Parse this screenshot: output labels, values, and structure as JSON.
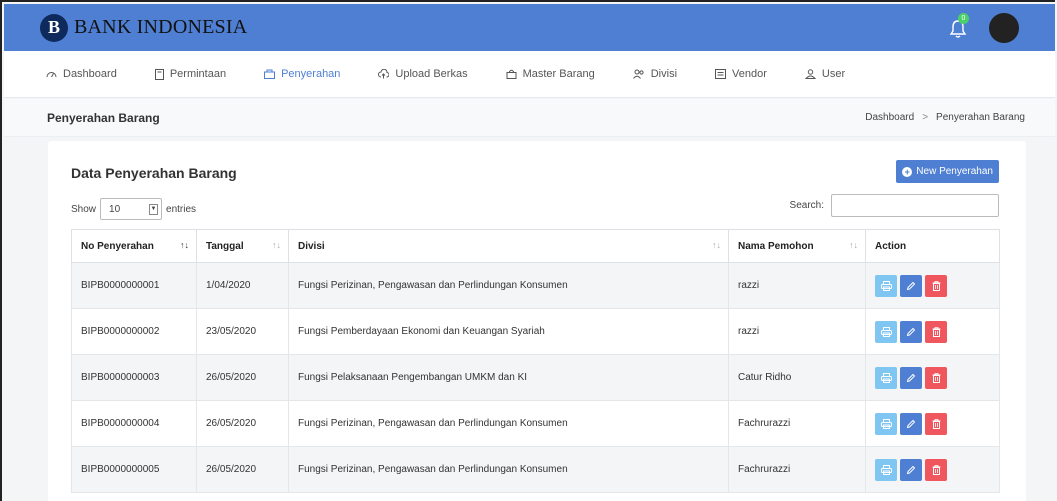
{
  "brand": {
    "name": "BANK INDONESIA",
    "logo_letter": "B"
  },
  "notifications": {
    "count": "0"
  },
  "nav": [
    {
      "label": "Dashboard",
      "icon": "dashboard-icon",
      "active": false
    },
    {
      "label": "Permintaan",
      "icon": "document-icon",
      "active": false
    },
    {
      "label": "Penyerahan",
      "icon": "handover-icon",
      "active": true
    },
    {
      "label": "Upload Berkas",
      "icon": "upload-icon",
      "active": false
    },
    {
      "label": "Master Barang",
      "icon": "box-icon",
      "active": false
    },
    {
      "label": "Divisi",
      "icon": "group-icon",
      "active": false
    },
    {
      "label": "Vendor",
      "icon": "vendor-icon",
      "active": false
    },
    {
      "label": "User",
      "icon": "user-icon",
      "active": false
    }
  ],
  "page": {
    "title": "Penyerahan Barang",
    "breadcrumb": [
      "Dashboard",
      "Penyerahan Barang"
    ]
  },
  "card": {
    "title": "Data Penyerahan Barang",
    "new_button": "New Penyerahan",
    "show_label": "Show",
    "show_value": "10",
    "entries_label": "entries",
    "search_label": "Search:"
  },
  "table": {
    "columns": [
      "No Penyerahan",
      "Tanggal",
      "Divisi",
      "Nama Pemohon",
      "Action"
    ],
    "rows": [
      {
        "no": "BIPB0000000001",
        "tanggal": "1/04/2020",
        "divisi": "Fungsi Perizinan, Pengawasan dan Perlindungan Konsumen",
        "pemohon": "razzi"
      },
      {
        "no": "BIPB0000000002",
        "tanggal": "23/05/2020",
        "divisi": "Fungsi Pemberdayaan Ekonomi dan Keuangan Syariah",
        "pemohon": "razzi"
      },
      {
        "no": "BIPB0000000003",
        "tanggal": "26/05/2020",
        "divisi": "Fungsi Pelaksanaan Pengembangan UMKM dan KI",
        "pemohon": "Catur Ridho"
      },
      {
        "no": "BIPB0000000004",
        "tanggal": "26/05/2020",
        "divisi": "Fungsi Perizinan, Pengawasan dan Perlindungan Konsumen",
        "pemohon": "Fachrurazzi"
      },
      {
        "no": "BIPB0000000005",
        "tanggal": "26/05/2020",
        "divisi": "Fungsi Perizinan, Pengawasan dan Perlindungan Konsumen",
        "pemohon": "Fachrurazzi"
      }
    ]
  },
  "colors": {
    "primary": "#4f7fd2",
    "print": "#7fc6f2",
    "delete": "#f0565d",
    "navy": "#0e2a5c"
  }
}
